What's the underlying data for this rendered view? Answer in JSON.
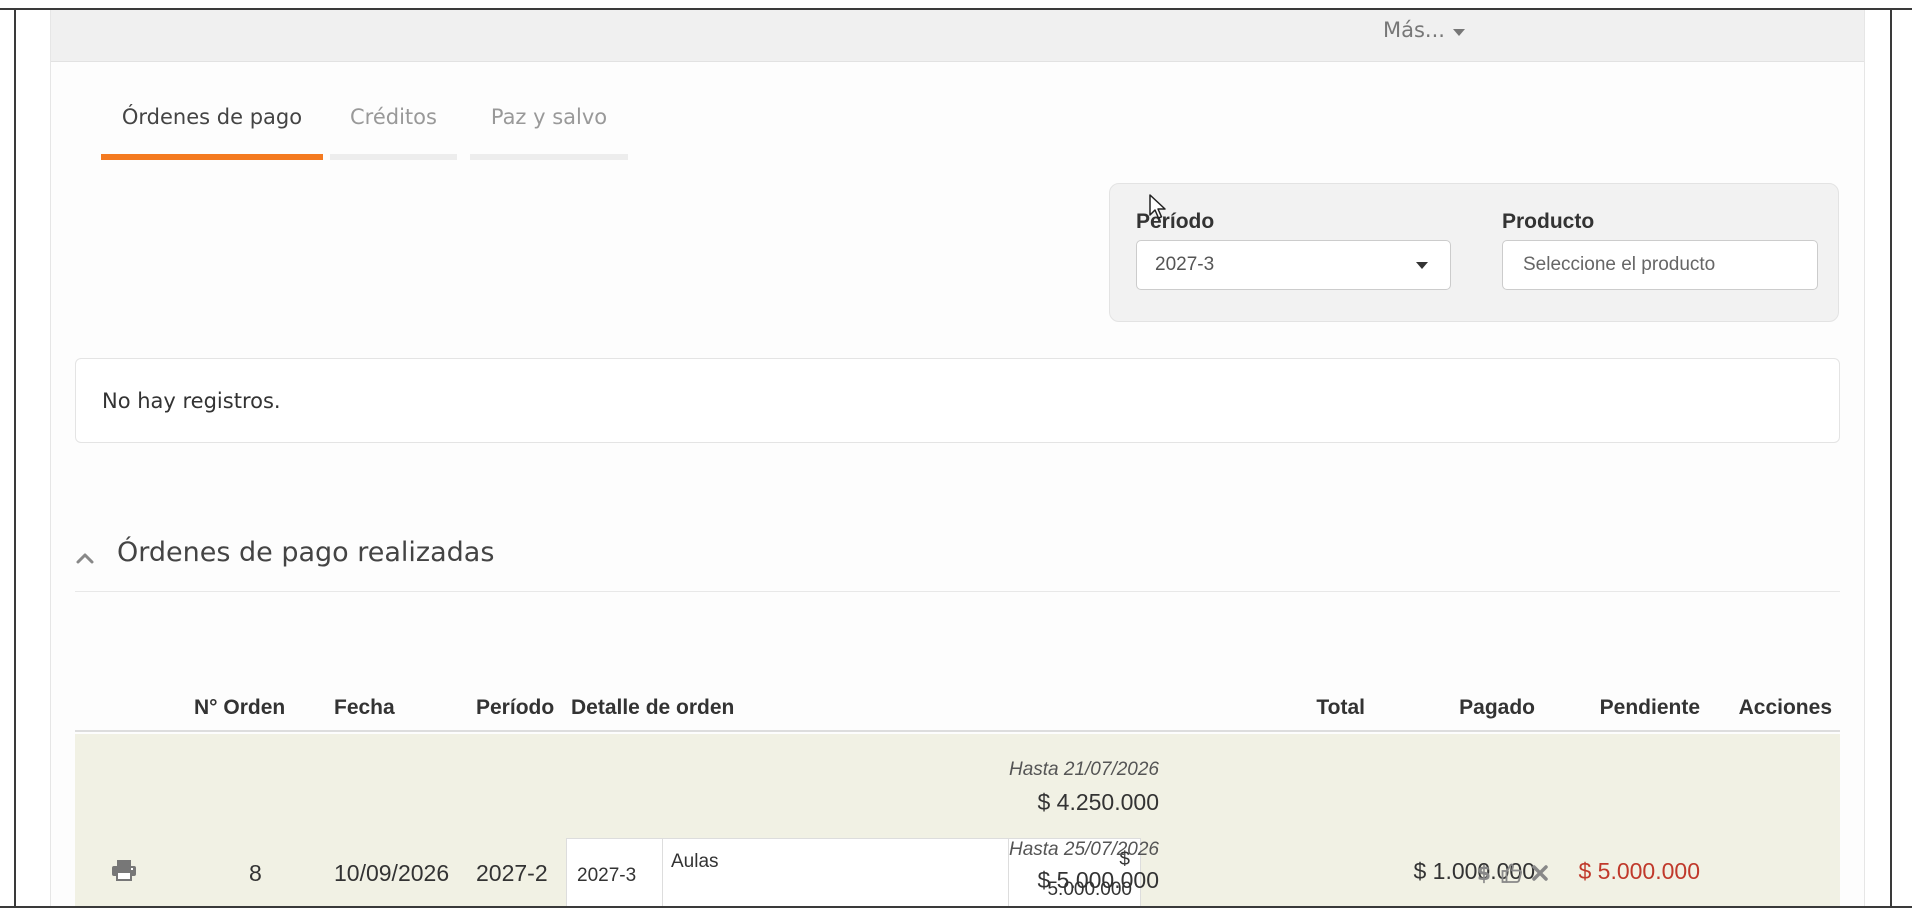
{
  "header": {
    "more_menu_label": "Más..."
  },
  "tabs": [
    {
      "label": "Órdenes de pago",
      "active": true
    },
    {
      "label": "Créditos",
      "active": false
    },
    {
      "label": "Paz y salvo",
      "active": false
    }
  ],
  "filters": {
    "periodo_label": "Período",
    "periodo_value": "2027-3",
    "producto_label": "Producto",
    "producto_placeholder": "Seleccione el producto"
  },
  "empty_message": "No hay registros.",
  "section": {
    "title": "Órdenes de pago realizadas"
  },
  "table": {
    "columns": {
      "numero": "N° Orden",
      "fecha": "Fecha",
      "periodo": "Período",
      "detalle": "Detalle de orden",
      "total": "Total",
      "pagado": "Pagado",
      "pendiente": "Pendiente",
      "acciones": "Acciones"
    },
    "rows": [
      {
        "numero": "8",
        "fecha": "10/09/2026",
        "periodo": "2027-2",
        "detalle": {
          "periodo": "2027-3",
          "concepto": "Aulas",
          "valor_symbol": "$",
          "valor": "5.000.000"
        },
        "total_1_label": "Hasta 21/07/2026",
        "total_1_amount": "$ 4.250.000",
        "total_2_label": "Hasta 25/07/2026",
        "total_2_amount": "$ 5.000.000",
        "pagado": "$ 1.000.000",
        "pendiente": "$ 5.000.000"
      }
    ]
  },
  "colors": {
    "accent": "#f47a20",
    "pending": "#c0392b",
    "row_bg": "#f1f1e4"
  },
  "icons": [
    "caret-down-icon",
    "chevron-up-icon",
    "print-icon",
    "dollar-icon",
    "thumbs-up-icon",
    "times-icon",
    "mouse-cursor-icon"
  ]
}
